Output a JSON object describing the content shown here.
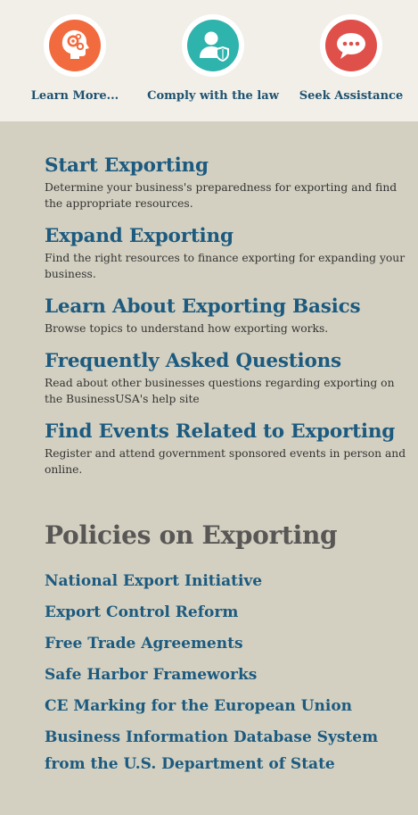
{
  "tiles": [
    {
      "label": "Learn More...",
      "icon": "head-gears-icon",
      "color": "#f26b3f"
    },
    {
      "label": "Comply with the law",
      "icon": "user-shield-icon",
      "color": "#2fb3ad"
    },
    {
      "label": "Seek Assistance",
      "icon": "chat-bubble-icon",
      "color": "#e0504a"
    }
  ],
  "sections": [
    {
      "title": "Start Exporting",
      "desc": "Determine your business's preparedness for exporting and find the appropriate resources."
    },
    {
      "title": "Expand Exporting",
      "desc": "Find the right resources to finance exporting for expanding your business."
    },
    {
      "title": "Learn About Exporting Basics",
      "desc": "Browse topics to understand how exporting works."
    },
    {
      "title": "Frequently Asked Questions",
      "desc": "Read about other businesses questions regarding exporting on the BusinessUSA's help site"
    },
    {
      "title": "Find Events Related to Exporting",
      "desc": "Register and attend government sponsored events in person and online."
    }
  ],
  "policies": {
    "title": "Policies on Exporting",
    "links": [
      "National Export Initiative",
      "Export Control Reform",
      "Free Trade Agreements",
      "Safe Harbor Frameworks",
      "CE Marking for the European Union",
      "Business Information Database System from the U.S. Department of State"
    ]
  },
  "colors": {
    "link": "#1c5a7f",
    "heading_gray": "#595755",
    "top_band": "#f1efe8",
    "background": "#d3d0c1"
  }
}
